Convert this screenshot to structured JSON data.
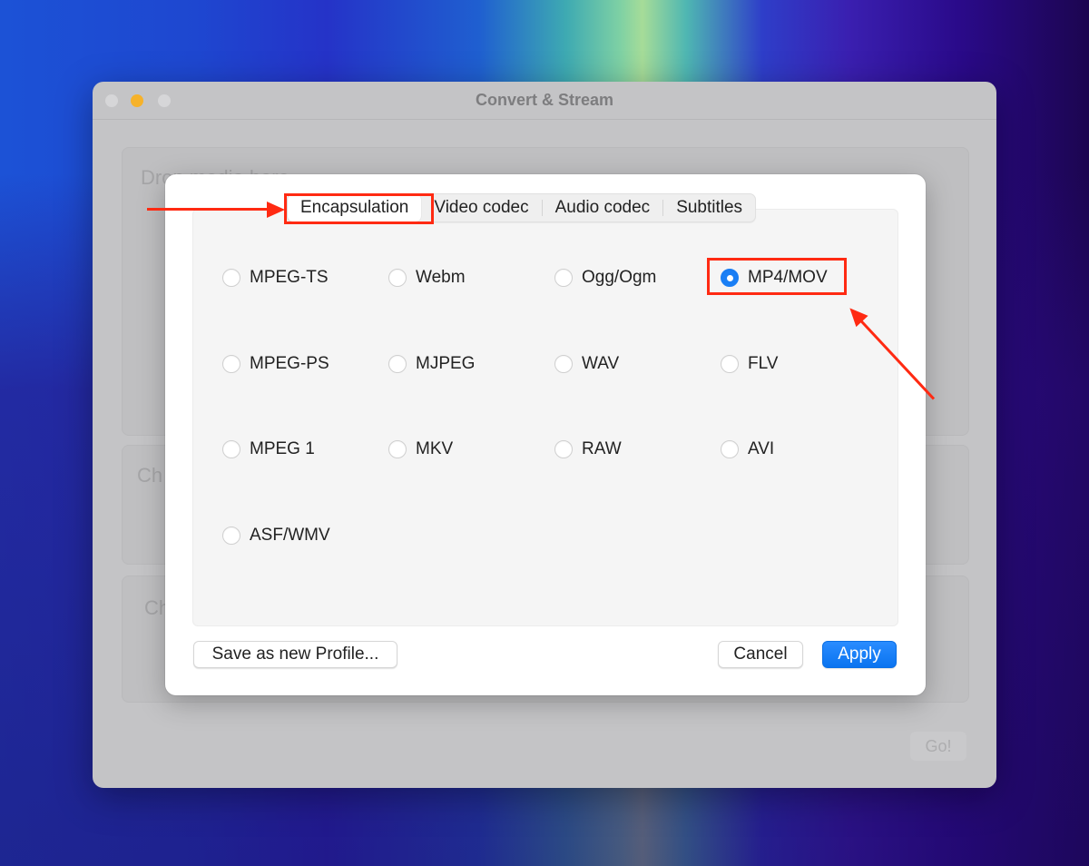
{
  "window": {
    "title": "Convert & Stream",
    "background_texts": [
      "Drop media here",
      "Ch",
      "Ch"
    ],
    "go_label": "Go!"
  },
  "dialog": {
    "tabs": [
      {
        "label": "Encapsulation",
        "active": true
      },
      {
        "label": "Video codec",
        "active": false
      },
      {
        "label": "Audio codec",
        "active": false
      },
      {
        "label": "Subtitles",
        "active": false
      }
    ],
    "formats": [
      {
        "label": "MPEG-TS",
        "checked": false
      },
      {
        "label": "Webm",
        "checked": false
      },
      {
        "label": "Ogg/Ogm",
        "checked": false
      },
      {
        "label": "MP4/MOV",
        "checked": true
      },
      {
        "label": "MPEG-PS",
        "checked": false
      },
      {
        "label": "MJPEG",
        "checked": false
      },
      {
        "label": "WAV",
        "checked": false
      },
      {
        "label": "FLV",
        "checked": false
      },
      {
        "label": "MPEG 1",
        "checked": false
      },
      {
        "label": "MKV",
        "checked": false
      },
      {
        "label": "RAW",
        "checked": false
      },
      {
        "label": "AVI",
        "checked": false
      },
      {
        "label": "ASF/WMV",
        "checked": false
      }
    ],
    "buttons": {
      "save_profile": "Save as new Profile...",
      "cancel": "Cancel",
      "apply": "Apply"
    }
  },
  "annotations": {
    "color": "#ff2a12",
    "highlighted": [
      "Encapsulation",
      "MP4/MOV"
    ]
  }
}
